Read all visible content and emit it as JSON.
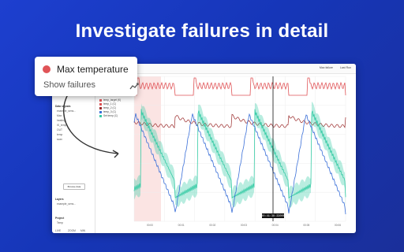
{
  "headline": "Investigate failures in detail",
  "callout": {
    "title": "Max temperature",
    "action": "Show failures",
    "action_icon": "trend-icon",
    "dot_color": "#e05457"
  },
  "app": {
    "brand": "",
    "topbar_right": [
      "Max failure",
      "Last Run"
    ],
    "sidebar": {
      "data_signals": "Data signals",
      "signal_items": [
        "example_sens...",
        "Max",
        "heating",
        "IS_temp",
        "OUT",
        "temp",
        "scan"
      ],
      "browse": "Browse data",
      "layers": "Layers",
      "layer_item": "example_sens...",
      "project": "Project",
      "project_sub": "Temp",
      "footer": [
        "LIVE",
        "ZOOM",
        "MIN"
      ]
    },
    "legend": [
      {
        "label": "temp_target (K)",
        "color": "#e05457"
      },
      {
        "label": "temp_1 (C)",
        "color": "#e05457"
      },
      {
        "label": "temp_2 (C)",
        "color": "#9b2b2b"
      },
      {
        "label": "temp_3 (C)",
        "color": "#3a6fd8"
      },
      {
        "label": "Set temp (C)",
        "color": "#36cba5"
      }
    ],
    "cursor_label": "00:41:38:33000",
    "x_ticks": [
      "00:00",
      "00:01",
      "00:02",
      "00:03",
      "00:04",
      "00:05",
      "00:06"
    ],
    "colors": {
      "teal": "#36cba5",
      "red": "#e05457",
      "darkred": "#9b2b2b",
      "blue": "#3a6fd8",
      "highlight": "#fbe4e3"
    }
  }
}
